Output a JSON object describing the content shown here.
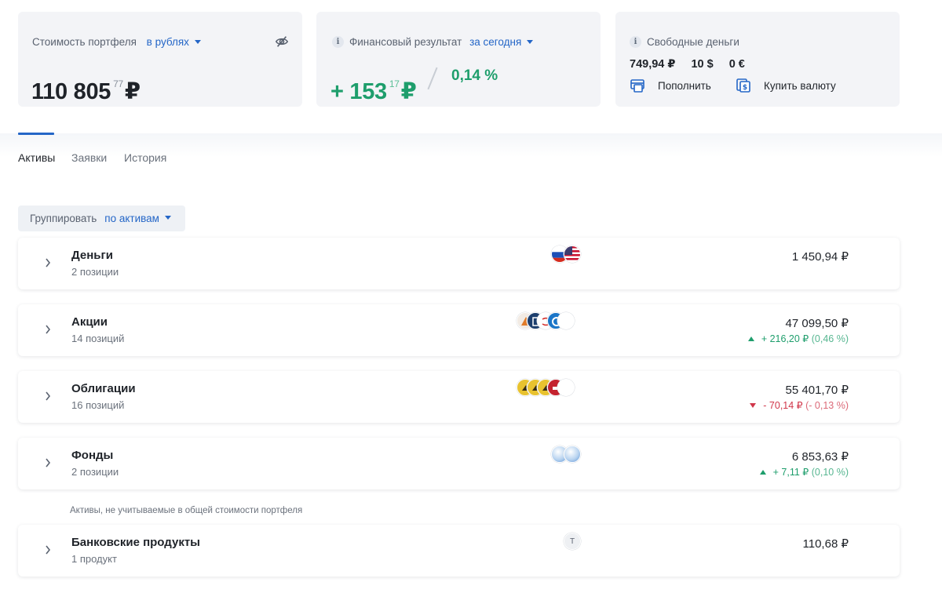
{
  "portfolio": {
    "label": "Стоимость портфеля",
    "currency_select": "в рублях",
    "value_main": "110 805",
    "value_frac": "77",
    "currency_sign": "₽"
  },
  "financial_result": {
    "label": "Финансовый результат",
    "period_select": "за сегодня",
    "value_main": "+ 153",
    "value_frac": "17",
    "currency_sign": "₽",
    "percent": "0,14 %"
  },
  "free_money": {
    "label": "Свободные деньги",
    "rub": "749,94 ₽",
    "usd": "10 $",
    "eur": "0 €",
    "topup_label": "Пополнить",
    "buy_currency_label": "Купить валюту"
  },
  "tabs": [
    {
      "label": "Активы"
    },
    {
      "label": "Заявки"
    },
    {
      "label": "История"
    }
  ],
  "grouping": {
    "label": "Группировать",
    "select": "по активам"
  },
  "rows": [
    {
      "title": "Деньги",
      "subtitle": "2 позиции",
      "value": "1 450,94 ₽"
    },
    {
      "title": "Акции",
      "subtitle": "14 позиций",
      "value": "47 099,50 ₽",
      "change": "+ 216,20 ₽",
      "change_pct": "(0,46 %)",
      "direction": "up"
    },
    {
      "title": "Облигации",
      "subtitle": "16 позиций",
      "value": "55 401,70 ₽",
      "change": "- 70,14 ₽",
      "change_pct": "(- 0,13 %)",
      "direction": "down"
    },
    {
      "title": "Фонды",
      "subtitle": "2 позиции",
      "value": "6 853,63 ₽",
      "change": "+ 7,11 ₽",
      "change_pct": "(0,10 %)",
      "direction": "up"
    }
  ],
  "excluded_note": "Активы, не учитываемые в общей стоимости портфеля",
  "bank_row": {
    "title": "Банковские продукты",
    "subtitle": "1 продукт",
    "value": "110,68 ₽",
    "logo_letter": "Т"
  },
  "colors": {
    "accent": "#2466c7",
    "positive": "#1e9e6c",
    "negative": "#d0364a",
    "card_bg": "#f3f4f7"
  },
  "icons": {
    "hide_value": "eye-slash-icon",
    "info": "info-icon",
    "topup": "wallet-in-icon",
    "buy_currency": "currency-exchange-icon",
    "expand": "chevron-right-icon"
  }
}
